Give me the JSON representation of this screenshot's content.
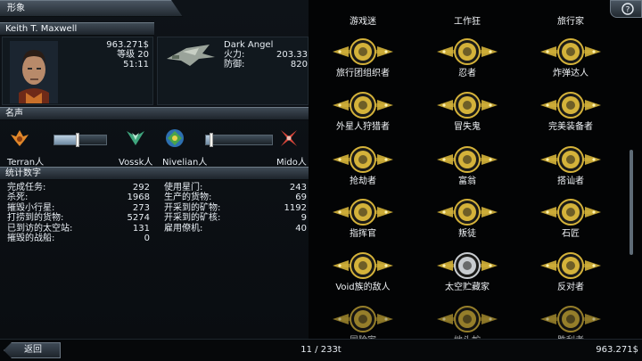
{
  "header": {
    "title": "形象"
  },
  "pilot": {
    "name": "Keith T. Maxwell",
    "credits": "963.271$",
    "level": "等级 20",
    "time": "51:11"
  },
  "ship": {
    "name": "Dark Angel",
    "firepower_label": "火力:",
    "firepower_value": "203.33",
    "defense_label": "防御:",
    "defense_value": "820"
  },
  "reputation": {
    "title": "名声",
    "factions": [
      {
        "name": "Terran人",
        "icon": "terran-emblem-icon",
        "color": "#e0872a"
      },
      {
        "name": "Vossk人",
        "icon": "vossk-emblem-icon",
        "color": "#3fa57d"
      },
      {
        "name": "Nivelian人",
        "icon": "nivelian-emblem-icon",
        "color": "#4aa34a"
      },
      {
        "name": "Mido人",
        "icon": "mido-emblem-icon",
        "color": "#d8463a"
      }
    ],
    "sliders": [
      {
        "value": 0.45
      },
      {
        "value": 0.08
      }
    ]
  },
  "stats": {
    "title": "统计数字",
    "left": [
      {
        "label": "完成任务:",
        "value": "292"
      },
      {
        "label": "杀死:",
        "value": "1968"
      },
      {
        "label": "摧毁小行星:",
        "value": "273"
      },
      {
        "label": "打捞到的货物:",
        "value": "5274"
      },
      {
        "label": "已到访的太空站:",
        "value": "131"
      },
      {
        "label": "摧毁的战船:",
        "value": "0"
      }
    ],
    "right": [
      {
        "label": "使用星门:",
        "value": "243"
      },
      {
        "label": "生产的货物:",
        "value": "69"
      },
      {
        "label": "开采到的矿物:",
        "value": "1192"
      },
      {
        "label": "开采到的矿核:",
        "value": "9"
      },
      {
        "label": "雇用僚机:",
        "value": "40"
      }
    ]
  },
  "medals": {
    "top_partial": [
      "游戏迷",
      "工作狂",
      "旅行家"
    ],
    "rows": [
      [
        "旅行团组织者",
        "忍者",
        "炸弹达人"
      ],
      [
        "外星人狩猎者",
        "冒失鬼",
        "完美装备者"
      ],
      [
        "抢劫者",
        "富翁",
        "搭讪者"
      ],
      [
        "指挥官",
        "叛徒",
        "石匠"
      ],
      [
        "Void族的敌人",
        "太空贮藏家",
        "反对者"
      ]
    ],
    "bottom_partial": [
      "冒险家",
      "地头蛇",
      "胜利者"
    ],
    "colors": {
      "gold": "#d4b23a",
      "dark": "#1a1a18",
      "silver": "#c8ccd0"
    }
  },
  "footer": {
    "back_label": "返回",
    "page_count": "11 / 233t",
    "credits": "963.271$"
  }
}
